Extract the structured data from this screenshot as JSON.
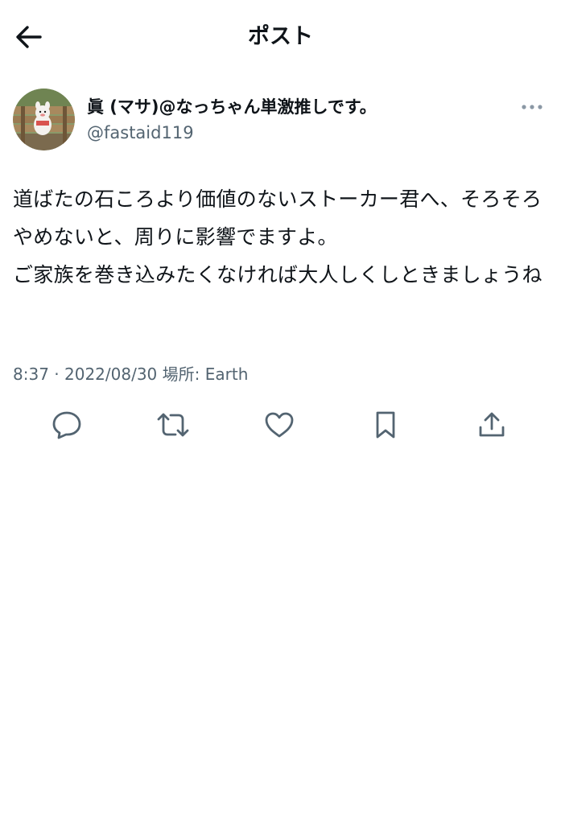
{
  "header": {
    "title": "ポスト",
    "back_icon": "arrow-left-icon"
  },
  "post": {
    "author": {
      "display_name": "眞 (マサ)@なっちゃん単激推しです。",
      "handle": "@fastaid119"
    },
    "text_lines": [
      "道ばたの石ころより価値のないストーカー君へ、そろそろやめないと、周りに影響でますよ。",
      "ご家族を巻き込みたくなければ大人しくしときましょうね"
    ],
    "time": "8:37",
    "separator": "·",
    "date": "2022/08/30",
    "location_label": "場所:",
    "location": "Earth"
  },
  "actions": {
    "icons": [
      "reply-icon",
      "repost-icon",
      "like-icon",
      "bookmark-icon",
      "share-icon"
    ]
  },
  "colors": {
    "text": "#0f1419",
    "secondary": "#536471",
    "background": "#ffffff"
  }
}
